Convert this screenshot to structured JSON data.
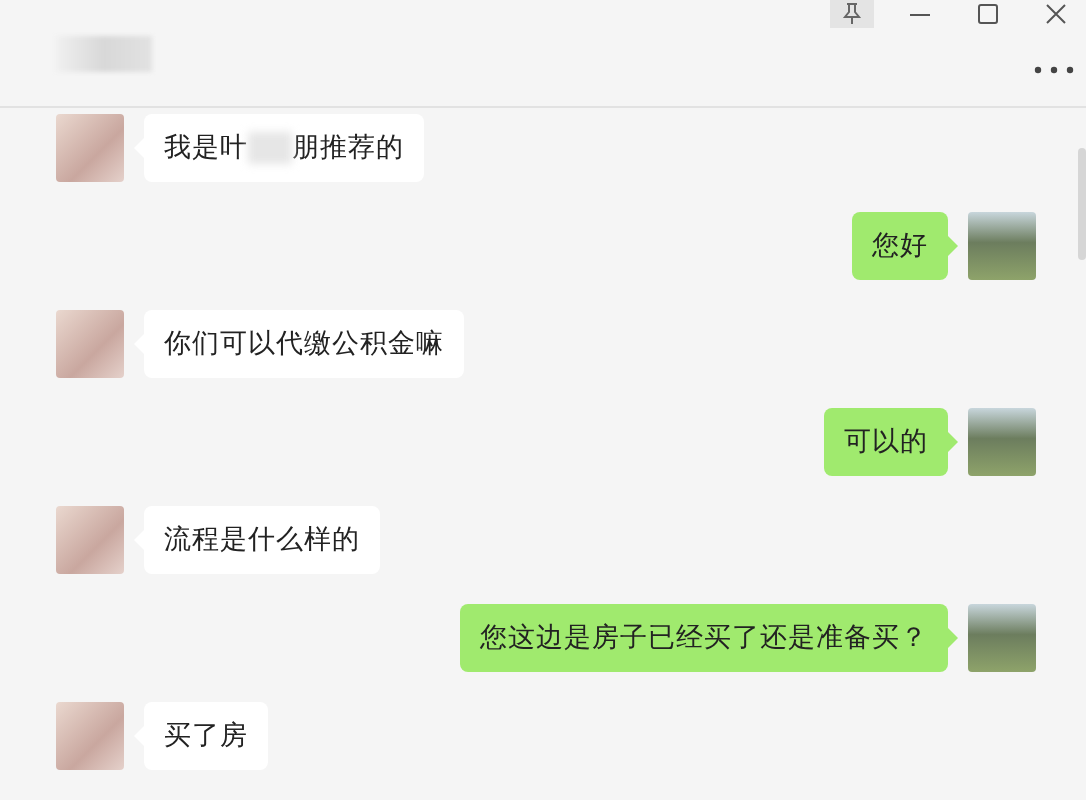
{
  "window": {
    "pinned": true
  },
  "messages": [
    {
      "kind": "incoming",
      "parts": [
        {
          "kind": "text",
          "text": "我是叶"
        },
        {
          "kind": "blur"
        },
        {
          "kind": "text",
          "text": "朋推荐的"
        }
      ]
    },
    {
      "kind": "outgoing",
      "parts": [
        {
          "kind": "text",
          "text": "您好"
        }
      ]
    },
    {
      "kind": "incoming",
      "parts": [
        {
          "kind": "text",
          "text": "你们可以代缴公积金嘛"
        }
      ]
    },
    {
      "kind": "outgoing",
      "parts": [
        {
          "kind": "text",
          "text": "可以的"
        }
      ]
    },
    {
      "kind": "incoming",
      "parts": [
        {
          "kind": "text",
          "text": "流程是什么样的"
        }
      ]
    },
    {
      "kind": "outgoing",
      "parts": [
        {
          "kind": "text",
          "text": "您这边是房子已经买了还是准备买？"
        }
      ]
    },
    {
      "kind": "incoming",
      "parts": [
        {
          "kind": "text",
          "text": "买了房"
        }
      ]
    }
  ]
}
